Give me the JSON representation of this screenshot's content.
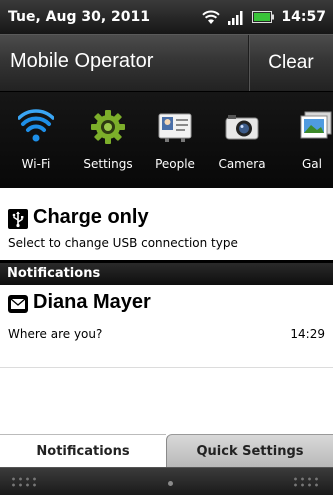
{
  "status_bar": {
    "date": "Tue, Aug 30, 2011",
    "time": "14:57",
    "icons": [
      "wifi-icon",
      "signal-icon",
      "battery-icon"
    ]
  },
  "header": {
    "carrier": "Mobile Operator",
    "clear_label": "Clear"
  },
  "quick_apps": [
    {
      "label": "Wi-Fi",
      "icon": "wifi-icon"
    },
    {
      "label": "Settings",
      "icon": "gear-icon"
    },
    {
      "label": "People",
      "icon": "contact-card-icon"
    },
    {
      "label": "Camera",
      "icon": "camera-icon"
    },
    {
      "label": "Gal",
      "icon": "gallery-icon"
    }
  ],
  "usb_notice": {
    "title": "Charge only",
    "subtitle": "Select to change USB connection type",
    "icon": "usb-icon"
  },
  "notifications_header": "Notifications",
  "notifications": [
    {
      "sender": "Diana Mayer",
      "message": "Where are you?",
      "time": "14:29",
      "icon": "message-icon"
    }
  ],
  "tabs": [
    {
      "label": "Notifications",
      "active": true
    },
    {
      "label": "Quick Settings",
      "active": false
    }
  ],
  "colors": {
    "wifi_blue": "#1e8fe8",
    "settings_green": "#7cae2a",
    "battery_green": "#39c339"
  }
}
